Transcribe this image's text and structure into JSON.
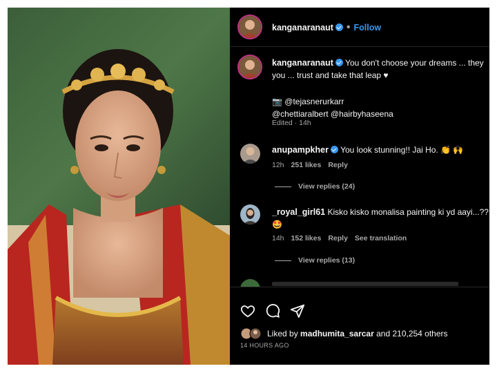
{
  "post": {
    "username": "kanganaranaut",
    "follow_label": "Follow",
    "separator": "•"
  },
  "caption": {
    "username": "kanganaranaut",
    "text_line1": "You don't choose your dreams ... they",
    "text_line2": "you ... trust and take that leap ♥",
    "credit_line1": "📷 @tejasnerurkarr",
    "credit_line2": "@chettiaralbert @hairbyhaseena",
    "edited": "Edited · 14h"
  },
  "comments": [
    {
      "username": "anupampkher",
      "text": "You look stunning!! Jai Ho. 👏 🙌",
      "time": "12h",
      "likes": "251 likes",
      "reply": "Reply",
      "view_replies": "View replies (24)"
    },
    {
      "username": "_royal_girl61",
      "text": "Kisko kisko monalisa painting ki yd aayi...??",
      "text_line2": "🤩",
      "time": "14h",
      "likes": "152 likes",
      "reply": "Reply",
      "see_translation": "See translation",
      "view_replies": "View replies (13)"
    }
  ],
  "footer": {
    "liked_by_prefix": "Liked by",
    "liked_by_user": "madhumita_sarcar",
    "liked_by_suffix": "and 210,254 others",
    "timestamp": "14 HOURS AGO"
  },
  "icons": {
    "like": "heart-icon",
    "comment": "comment-icon",
    "share": "share-icon",
    "verified": "verified-badge-icon"
  },
  "colors": {
    "accent": "#3897f0",
    "background": "#000000",
    "secondary_text": "#a8a8a8"
  }
}
